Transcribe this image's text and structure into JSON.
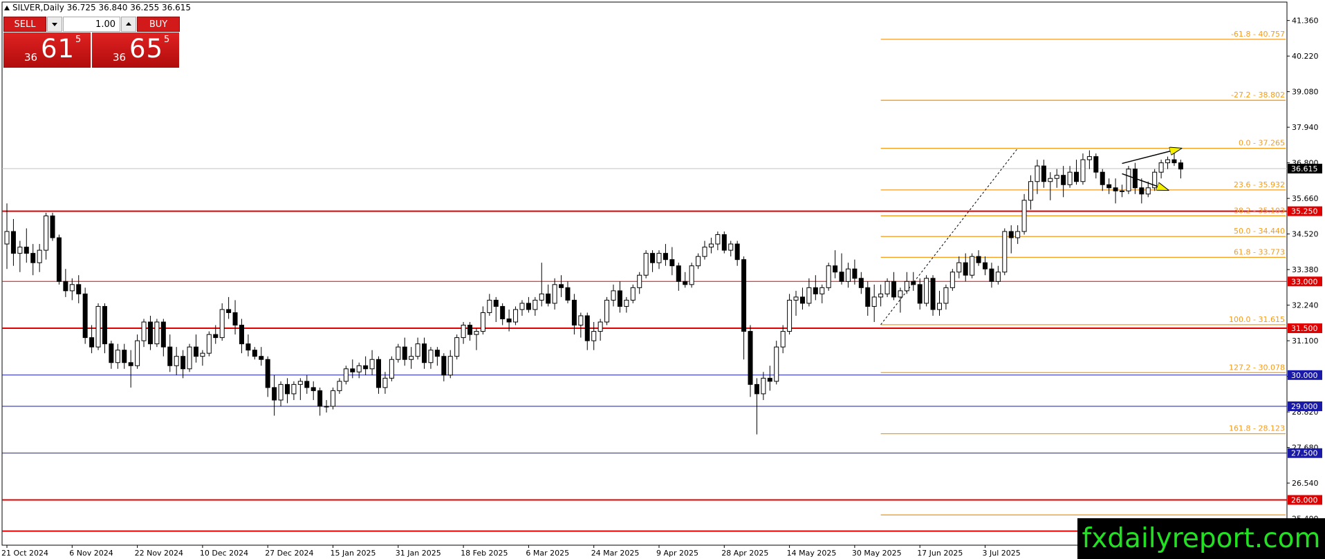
{
  "header": {
    "symbol_line": "SILVER,Daily  36.725 36.840 36.255 36.615"
  },
  "trade_panel": {
    "sell_label": "SELL",
    "buy_label": "BUY",
    "lot_value": "1.00",
    "sell_small": "36",
    "sell_big": "61",
    "sell_sup": "5",
    "buy_small": "36",
    "buy_big": "65",
    "buy_sup": "5"
  },
  "watermark": "fxdailyreport.com",
  "chart_data": {
    "type": "candlestick",
    "ylim": [
      24.55,
      41.95
    ],
    "price_ticks": [
      "41.360",
      "40.220",
      "39.080",
      "37.940",
      "36.800",
      "35.660",
      "34.520",
      "33.380",
      "32.240",
      "31.100",
      "29.960",
      "28.820",
      "27.680",
      "26.540",
      "25.400"
    ],
    "date_labels": [
      "21 Oct 2024",
      "6 Nov 2024",
      "22 Nov 2024",
      "10 Dec 2024",
      "27 Dec 2024",
      "15 Jan 2025",
      "31 Jan 2025",
      "18 Feb 2025",
      "6 Mar 2025",
      "24 Mar 2025",
      "9 Apr 2025",
      "28 Apr 2025",
      "14 May 2025",
      "30 May 2025",
      "17 Jun 2025",
      "3 Jul 2025"
    ],
    "current_price": {
      "label": "36.615",
      "value": 36.615
    },
    "levels": [
      {
        "value": 35.25,
        "label": "35.250",
        "color": "#e00000",
        "bg": "#e00000",
        "width": 2
      },
      {
        "value": 33.0,
        "label": "33.000",
        "color": "#e00000",
        "bg": "#e00000",
        "width": 1
      },
      {
        "value": 31.5,
        "label": "31.500",
        "color": "#e00000",
        "bg": "#e00000",
        "width": 2
      },
      {
        "value": 30.0,
        "label": "30.000",
        "color": "#1a1aa8",
        "bg": "#1a1aa8",
        "width": 1
      },
      {
        "value": 29.0,
        "label": "29.000",
        "color": "#1a1aa8",
        "bg": "#1a1aa8",
        "width": 1
      },
      {
        "value": 27.5,
        "label": "27.500",
        "color": "#1a1aa8",
        "bg": "#1a1aa8",
        "width": 1
      },
      {
        "value": 26.0,
        "label": "26.000",
        "color": "#e00000",
        "bg": "#e00000",
        "width": 2
      },
      {
        "value": 25.0,
        "label": "25.000",
        "color": "#e00000",
        "bg": "#e00000",
        "width": 2
      }
    ],
    "fibo_color": "#f39c1e",
    "fibo": [
      {
        "value": 40.757,
        "label": "-61.8 - 40.757"
      },
      {
        "value": 38.802,
        "label": "-27.2 - 38.802"
      },
      {
        "value": 37.265,
        "label": "0.0 - 37.265"
      },
      {
        "value": 35.932,
        "label": "23.6 - 35.932"
      },
      {
        "value": 35.103,
        "label": "38.2 - 35.103"
      },
      {
        "value": 34.44,
        "label": "50.0 - 34.440"
      },
      {
        "value": 33.773,
        "label": "61.8 - 33.773"
      },
      {
        "value": 31.615,
        "label": "100.0 - 31.615"
      },
      {
        "value": 30.078,
        "label": "127.2 - 30.078"
      },
      {
        "value": 28.123,
        "label": "161.8 - 28.123"
      },
      {
        "value": 25.52,
        "label": ""
      }
    ],
    "fibo_anchor": {
      "from_bar": 134,
      "to_bar": 155,
      "from_value": 31.615,
      "to_value": 37.265
    },
    "arrows": [
      {
        "from_bar": 171,
        "from_value": 36.78,
        "to_bar": 180,
        "to_value": 37.26
      },
      {
        "from_bar": 171,
        "from_value": 36.45,
        "to_bar": 178,
        "to_value": 35.93
      }
    ],
    "candles": [
      [
        34.2,
        35.5,
        33.4,
        34.6
      ],
      [
        34.6,
        35.0,
        33.5,
        33.9
      ],
      [
        33.9,
        34.3,
        33.3,
        34.1
      ],
      [
        34.1,
        34.7,
        33.6,
        33.9
      ],
      [
        33.9,
        34.2,
        33.2,
        33.6
      ],
      [
        33.6,
        34.2,
        33.3,
        34.0
      ],
      [
        34.0,
        35.2,
        33.7,
        35.1
      ],
      [
        35.1,
        35.2,
        34.3,
        34.4
      ],
      [
        34.4,
        34.5,
        32.9,
        33.0
      ],
      [
        33.0,
        33.4,
        32.5,
        32.7
      ],
      [
        32.7,
        33.1,
        32.4,
        32.9
      ],
      [
        32.9,
        33.2,
        32.3,
        32.6
      ],
      [
        32.6,
        32.8,
        31.0,
        31.2
      ],
      [
        31.2,
        31.6,
        30.7,
        30.9
      ],
      [
        30.9,
        32.3,
        30.8,
        32.2
      ],
      [
        32.2,
        32.3,
        30.7,
        31.0
      ],
      [
        31.0,
        31.1,
        30.2,
        30.4
      ],
      [
        30.4,
        31.0,
        30.2,
        30.8
      ],
      [
        30.8,
        31.0,
        30.2,
        30.4
      ],
      [
        30.4,
        30.8,
        29.6,
        30.3
      ],
      [
        30.3,
        31.3,
        30.2,
        31.1
      ],
      [
        31.1,
        31.8,
        30.9,
        31.7
      ],
      [
        31.7,
        31.9,
        30.8,
        31.0
      ],
      [
        31.0,
        31.8,
        30.9,
        31.7
      ],
      [
        31.7,
        31.8,
        30.6,
        30.9
      ],
      [
        30.9,
        31.3,
        30.1,
        30.3
      ],
      [
        30.3,
        30.9,
        30.0,
        30.6
      ],
      [
        30.6,
        30.8,
        29.9,
        30.2
      ],
      [
        30.2,
        31.0,
        30.1,
        30.9
      ],
      [
        30.9,
        31.3,
        30.4,
        30.6
      ],
      [
        30.6,
        30.8,
        30.3,
        30.7
      ],
      [
        30.7,
        31.4,
        30.6,
        31.3
      ],
      [
        31.3,
        31.6,
        31.0,
        31.2
      ],
      [
        31.2,
        32.3,
        31.1,
        32.1
      ],
      [
        32.1,
        32.5,
        31.8,
        32.0
      ],
      [
        32.0,
        32.4,
        31.3,
        31.6
      ],
      [
        31.6,
        31.8,
        30.7,
        31.0
      ],
      [
        31.0,
        31.3,
        30.6,
        30.8
      ],
      [
        30.8,
        30.9,
        30.5,
        30.6
      ],
      [
        30.6,
        30.9,
        30.3,
        30.5
      ],
      [
        30.5,
        30.6,
        29.3,
        29.6
      ],
      [
        29.6,
        30.0,
        28.7,
        29.2
      ],
      [
        29.2,
        29.8,
        29.0,
        29.7
      ],
      [
        29.7,
        29.9,
        29.1,
        29.4
      ],
      [
        29.4,
        29.8,
        29.2,
        29.7
      ],
      [
        29.7,
        29.9,
        29.2,
        29.8
      ],
      [
        29.8,
        30.0,
        29.4,
        29.6
      ],
      [
        29.6,
        29.8,
        29.2,
        29.5
      ],
      [
        29.5,
        29.6,
        28.7,
        29.0
      ],
      [
        29.0,
        29.2,
        28.8,
        29.0
      ],
      [
        29.0,
        29.6,
        28.9,
        29.5
      ],
      [
        29.5,
        29.9,
        29.4,
        29.8
      ],
      [
        29.8,
        30.3,
        29.7,
        30.2
      ],
      [
        30.2,
        30.5,
        29.9,
        30.1
      ],
      [
        30.1,
        30.4,
        29.9,
        30.3
      ],
      [
        30.3,
        30.6,
        30.0,
        30.2
      ],
      [
        30.2,
        30.8,
        30.0,
        30.5
      ],
      [
        30.5,
        30.6,
        29.4,
        29.6
      ],
      [
        29.6,
        30.1,
        29.4,
        29.9
      ],
      [
        29.9,
        30.6,
        29.8,
        30.5
      ],
      [
        30.5,
        31.0,
        30.4,
        30.9
      ],
      [
        30.9,
        31.2,
        30.3,
        30.5
      ],
      [
        30.5,
        30.9,
        30.2,
        30.6
      ],
      [
        30.6,
        31.2,
        30.5,
        31.0
      ],
      [
        31.0,
        31.2,
        30.2,
        30.4
      ],
      [
        30.4,
        30.9,
        30.2,
        30.8
      ],
      [
        30.8,
        30.9,
        30.3,
        30.6
      ],
      [
        30.6,
        30.7,
        29.8,
        30.0
      ],
      [
        30.0,
        30.8,
        29.9,
        30.6
      ],
      [
        30.6,
        31.3,
        30.5,
        31.2
      ],
      [
        31.2,
        31.7,
        31.0,
        31.6
      ],
      [
        31.6,
        31.7,
        31.1,
        31.3
      ],
      [
        31.3,
        31.5,
        30.8,
        31.4
      ],
      [
        31.4,
        32.2,
        31.3,
        32.0
      ],
      [
        32.0,
        32.6,
        31.9,
        32.4
      ],
      [
        32.4,
        32.5,
        31.7,
        32.2
      ],
      [
        32.2,
        32.3,
        31.6,
        31.8
      ],
      [
        31.8,
        32.1,
        31.4,
        31.7
      ],
      [
        31.7,
        32.2,
        31.6,
        32.1
      ],
      [
        32.1,
        32.4,
        31.9,
        32.3
      ],
      [
        32.3,
        32.5,
        32.0,
        32.1
      ],
      [
        32.1,
        32.5,
        31.9,
        32.4
      ],
      [
        32.4,
        33.6,
        32.2,
        32.6
      ],
      [
        32.6,
        32.9,
        32.2,
        32.3
      ],
      [
        32.3,
        33.1,
        32.1,
        32.9
      ],
      [
        32.9,
        33.2,
        32.5,
        32.8
      ],
      [
        32.8,
        33.0,
        32.3,
        32.4
      ],
      [
        32.4,
        32.6,
        31.3,
        31.6
      ],
      [
        31.6,
        32.0,
        31.2,
        31.9
      ],
      [
        31.9,
        32.0,
        30.8,
        31.1
      ],
      [
        31.1,
        31.7,
        30.8,
        31.4
      ],
      [
        31.4,
        31.8,
        31.1,
        31.7
      ],
      [
        31.7,
        32.5,
        31.6,
        32.4
      ],
      [
        32.4,
        32.9,
        32.2,
        32.7
      ],
      [
        32.7,
        33.0,
        32.0,
        32.2
      ],
      [
        32.2,
        32.5,
        32.0,
        32.4
      ],
      [
        32.4,
        32.9,
        32.3,
        32.8
      ],
      [
        32.8,
        33.3,
        32.6,
        33.2
      ],
      [
        33.2,
        34.0,
        33.1,
        33.9
      ],
      [
        33.9,
        34.0,
        33.3,
        33.6
      ],
      [
        33.6,
        34.0,
        33.4,
        33.9
      ],
      [
        33.9,
        34.2,
        33.5,
        33.7
      ],
      [
        33.7,
        34.1,
        33.2,
        33.5
      ],
      [
        33.5,
        33.6,
        32.7,
        33.0
      ],
      [
        33.0,
        33.3,
        32.8,
        32.9
      ],
      [
        32.9,
        33.6,
        32.8,
        33.5
      ],
      [
        33.5,
        33.9,
        33.4,
        33.8
      ],
      [
        33.8,
        34.3,
        33.7,
        34.1
      ],
      [
        34.1,
        34.4,
        33.9,
        34.2
      ],
      [
        34.2,
        34.6,
        34.0,
        34.5
      ],
      [
        34.5,
        34.6,
        33.9,
        34.0
      ],
      [
        34.0,
        34.3,
        33.8,
        34.2
      ],
      [
        34.2,
        34.3,
        33.5,
        33.7
      ],
      [
        33.7,
        33.8,
        30.5,
        31.4
      ],
      [
        31.4,
        31.6,
        29.3,
        29.7
      ],
      [
        29.7,
        29.9,
        28.1,
        29.4
      ],
      [
        29.4,
        30.1,
        29.2,
        29.9
      ],
      [
        29.9,
        30.3,
        29.5,
        29.8
      ],
      [
        29.8,
        31.1,
        29.7,
        30.9
      ],
      [
        30.9,
        31.6,
        30.7,
        31.4
      ],
      [
        31.4,
        32.6,
        31.3,
        32.4
      ],
      [
        32.4,
        32.7,
        31.9,
        32.5
      ],
      [
        32.5,
        32.8,
        32.1,
        32.3
      ],
      [
        32.3,
        33.1,
        32.2,
        32.8
      ],
      [
        32.8,
        33.2,
        32.4,
        32.6
      ],
      [
        32.6,
        32.9,
        32.3,
        32.8
      ],
      [
        32.8,
        33.6,
        32.7,
        33.5
      ],
      [
        33.5,
        34.0,
        33.1,
        33.3
      ],
      [
        33.3,
        33.9,
        32.9,
        33.0
      ],
      [
        33.0,
        33.6,
        32.8,
        33.4
      ]
    ],
    "candles_2": [
      [
        33.4,
        33.7,
        32.9,
        33.1
      ],
      [
        33.1,
        33.3,
        32.6,
        32.8
      ],
      [
        32.8,
        33.0,
        31.9,
        32.2
      ],
      [
        32.2,
        32.9,
        31.7,
        32.5
      ],
      [
        32.5,
        32.9,
        32.2,
        32.6
      ],
      [
        32.6,
        33.1,
        32.5,
        33.0
      ],
      [
        33.0,
        33.3,
        32.4,
        32.5
      ],
      [
        32.5,
        32.8,
        32.0,
        32.7
      ],
      [
        32.7,
        33.3,
        32.6,
        33.0
      ],
      [
        33.0,
        33.3,
        32.7,
        32.9
      ],
      [
        32.9,
        33.1,
        32.1,
        32.3
      ],
      [
        32.3,
        33.2,
        32.2,
        33.1
      ],
      [
        33.1,
        33.2,
        31.9,
        32.1
      ],
      [
        32.1,
        32.7,
        31.9,
        32.3
      ],
      [
        32.3,
        32.9,
        32.1,
        32.8
      ],
      [
        32.8,
        33.4,
        32.7,
        33.3
      ],
      [
        33.3,
        33.8,
        33.1,
        33.6
      ],
      [
        33.6,
        33.9,
        33.0,
        33.2
      ],
      [
        33.2,
        33.9,
        33.1,
        33.8
      ],
      [
        33.8,
        34.0,
        33.5,
        33.6
      ],
      [
        33.6,
        33.8,
        33.2,
        33.4
      ],
      [
        33.4,
        33.6,
        32.8,
        33.0
      ],
      [
        33.0,
        33.5,
        32.9,
        33.3
      ],
      [
        33.3,
        34.7,
        33.2,
        34.6
      ],
      [
        34.6,
        34.8,
        33.9,
        34.4
      ],
      [
        34.4,
        34.8,
        34.2,
        34.6
      ],
      [
        34.6,
        35.8,
        34.5,
        35.6
      ],
      [
        35.6,
        36.4,
        35.3,
        36.2
      ],
      [
        36.2,
        36.9,
        35.8,
        36.7
      ],
      [
        36.7,
        36.9,
        36.0,
        36.2
      ],
      [
        36.2,
        36.5,
        35.6,
        36.3
      ],
      [
        36.3,
        36.6,
        36.0,
        36.4
      ],
      [
        36.4,
        36.7,
        35.7,
        36.1
      ],
      [
        36.1,
        36.7,
        36.0,
        36.5
      ],
      [
        36.5,
        36.9,
        36.1,
        36.2
      ],
      [
        36.2,
        37.1,
        36.1,
        36.9
      ],
      [
        36.9,
        37.2,
        36.6,
        37.0
      ],
      [
        37.0,
        37.1,
        36.3,
        36.5
      ],
      [
        36.5,
        36.6,
        35.9,
        36.1
      ],
      [
        36.1,
        36.3,
        35.8,
        36.0
      ],
      [
        36.0,
        36.3,
        35.5,
        35.9
      ],
      [
        35.9,
        36.1,
        35.7,
        35.9
      ],
      [
        35.9,
        36.7,
        35.8,
        36.6
      ],
      [
        36.6,
        36.8,
        35.8,
        36.0
      ],
      [
        36.0,
        36.3,
        35.5,
        35.8
      ],
      [
        35.8,
        36.2,
        35.7,
        36.0
      ],
      [
        36.0,
        36.6,
        35.9,
        36.5
      ],
      [
        36.5,
        36.9,
        36.3,
        36.8
      ],
      [
        36.8,
        37.0,
        36.6,
        36.9
      ],
      [
        36.9,
        37.2,
        36.7,
        36.8
      ],
      [
        36.8,
        36.9,
        36.3,
        36.6
      ]
    ]
  }
}
